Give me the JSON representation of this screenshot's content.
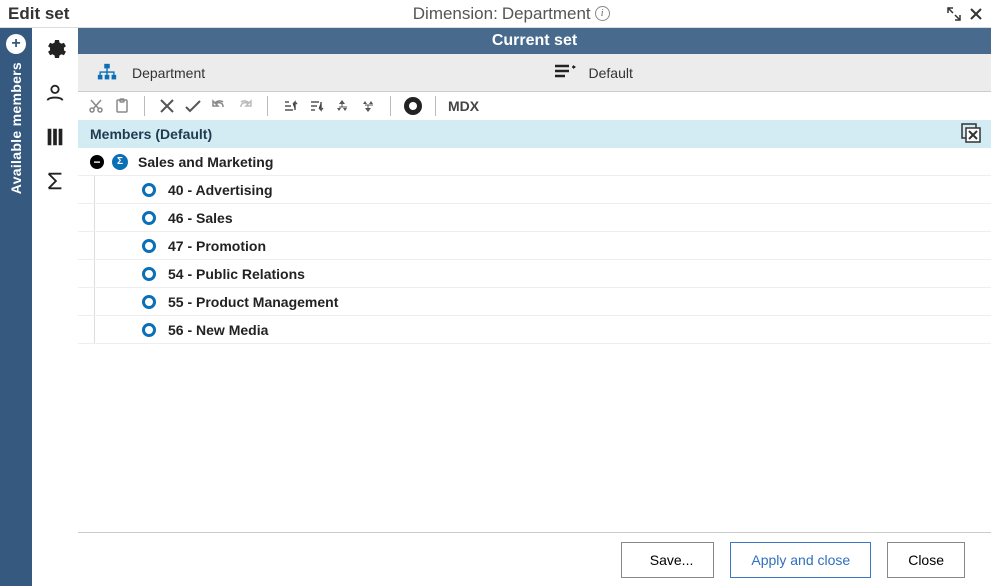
{
  "titlebar": {
    "left": "Edit set",
    "center_prefix": "Dimension:",
    "center_value": "Department"
  },
  "rail": {
    "label": "Available members"
  },
  "current_set_heading": "Current set",
  "selector": {
    "hierarchy_label": "Department",
    "subset_label": "Default"
  },
  "toolbar": {
    "mdx": "MDX"
  },
  "members": {
    "header": "Members (Default)",
    "parent": "Sales and Marketing",
    "children": [
      "40 - Advertising",
      "46 - Sales",
      "47 - Promotion",
      "54 - Public Relations",
      "55 - Product Management",
      "56 - New Media"
    ]
  },
  "footer": {
    "save": "Save...",
    "apply": "Apply and close",
    "close": "Close"
  }
}
